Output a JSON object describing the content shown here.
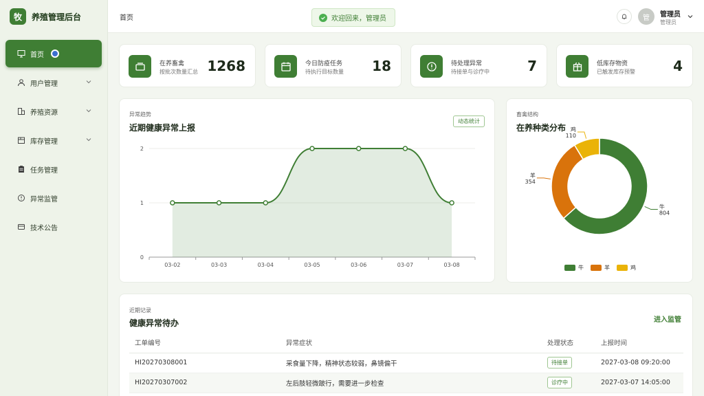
{
  "brand": {
    "logo_char": "牧",
    "name": "养殖管理后台"
  },
  "sidebar": {
    "items": [
      {
        "label": "首页",
        "icon": "monitor-icon"
      },
      {
        "label": "用户管理",
        "icon": "user-icon"
      },
      {
        "label": "养殖资源",
        "icon": "building-icon"
      },
      {
        "label": "库存管理",
        "icon": "box-icon"
      },
      {
        "label": "任务管理",
        "icon": "clipboard-icon"
      },
      {
        "label": "异常监管",
        "icon": "alert-icon"
      },
      {
        "label": "技术公告",
        "icon": "card-icon"
      }
    ]
  },
  "header": {
    "breadcrumb": "首页",
    "toast": "欢迎回来，管理员",
    "avatar_char": "管",
    "user_name": "管理员",
    "user_role": "管理员"
  },
  "stats": [
    {
      "title": "在养畜禽",
      "sub": "按批次数量汇总",
      "value": "1268"
    },
    {
      "title": "今日防疫任务",
      "sub": "待执行目标数量",
      "value": "18"
    },
    {
      "title": "待处理异常",
      "sub": "待接单与诊疗中",
      "value": "7"
    },
    {
      "title": "低库存物资",
      "sub": "已触发库存预警",
      "value": "4"
    }
  ],
  "trend": {
    "kicker": "异常趋势",
    "title": "近期健康异常上报",
    "chip": "动态统计"
  },
  "structure": {
    "kicker": "畜禽结构",
    "title": "在养种类分布"
  },
  "records": {
    "kicker": "近期记录",
    "title": "健康异常待办",
    "link": "进入监管",
    "columns": [
      "工单编号",
      "异常症状",
      "处理状态",
      "上报时间"
    ],
    "rows": [
      {
        "id": "HI20270308001",
        "symptom": "采食量下降，精神状态较弱，鼻镜偏干",
        "status": "待接单",
        "time": "2027-03-08 09:20:00"
      },
      {
        "id": "HI20270307002",
        "symptom": "左后肢轻微跛行，需要进一步检查",
        "status": "诊疗中",
        "time": "2027-03-07 14:05:00"
      }
    ]
  },
  "colors": {
    "primary": "#3f7e34",
    "orange": "#d9730b",
    "yellow": "#eab308"
  },
  "chart_data": [
    {
      "type": "area",
      "categories": [
        "03-02",
        "03-03",
        "03-04",
        "03-05",
        "03-06",
        "03-07",
        "03-08"
      ],
      "values": [
        1,
        1,
        1,
        2,
        2,
        2,
        1
      ],
      "yticks": [
        "0",
        "1",
        "2"
      ],
      "ylim": [
        0,
        2
      ],
      "color": "#3f7e34"
    },
    {
      "type": "pie",
      "categories": [
        "牛",
        "羊",
        "鸡"
      ],
      "values": [
        804,
        354,
        110
      ],
      "value_labels": [
        "804",
        "354",
        "110"
      ],
      "colors": [
        "#3f7e34",
        "#d9730b",
        "#eab308"
      ],
      "legend": "bottom"
    }
  ]
}
